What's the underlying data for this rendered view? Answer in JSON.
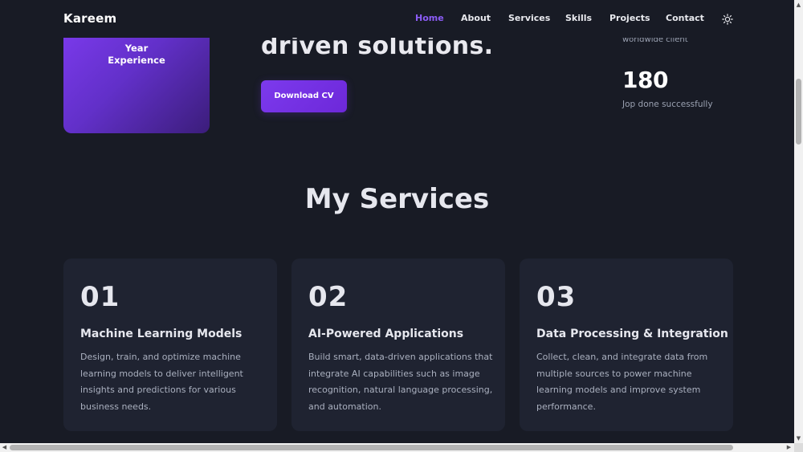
{
  "navbar": {
    "brand": "Kareem",
    "items": [
      {
        "label": "Home",
        "active": true
      },
      {
        "label": "About",
        "active": false
      },
      {
        "label": "Services",
        "active": false
      },
      {
        "label": "Skills",
        "active": false
      },
      {
        "label": "Projects",
        "active": false
      },
      {
        "label": "Contact",
        "active": false
      }
    ],
    "theme_icon": "sun-icon"
  },
  "hero": {
    "experience_text": "Year\nExperience",
    "title_fragment": "driven solutions.",
    "cv_button": "Download CV",
    "stats": {
      "prev_label": "worldwide client",
      "value": "180",
      "label": "Jop done successfully"
    }
  },
  "services": {
    "title": "My Services",
    "cards": [
      {
        "number": "01",
        "title": "Machine Learning Models",
        "description": "Design, train, and optimize machine learning models to deliver intelligent insights and predictions for various business needs."
      },
      {
        "number": "02",
        "title": "AI-Powered Applications",
        "description": "Build smart, data-driven applications that integrate AI capabilities such as image recognition, natural language processing, and automation."
      },
      {
        "number": "03",
        "title": "Data Processing & Integration",
        "description": "Collect, clean, and integrate data from multiple sources to power machine learning models and improve system performance."
      }
    ]
  },
  "colors": {
    "background": "#181b25",
    "card": "#1f2331",
    "accent": "#8b5cf6"
  }
}
